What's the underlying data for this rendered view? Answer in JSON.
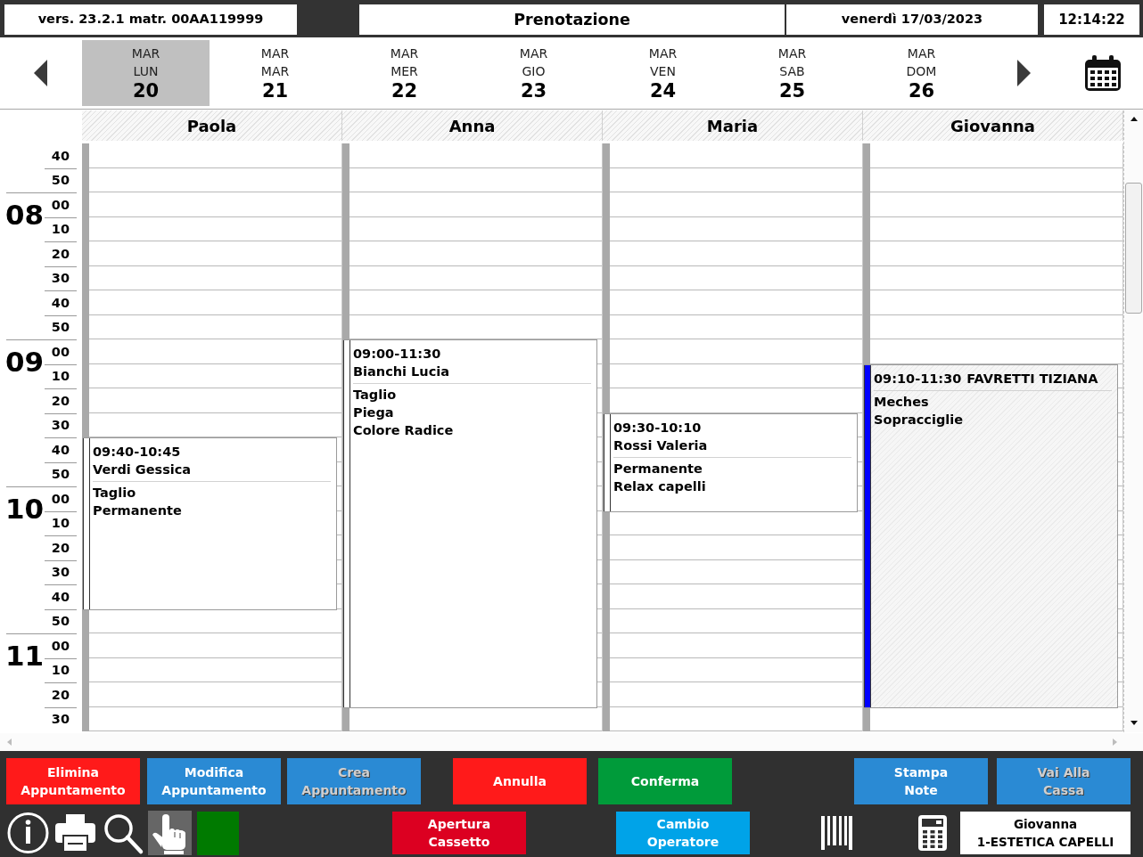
{
  "top_bar": {
    "version": "vers. 23.2.1 matr. 00AA119999",
    "title": "Prenotazione",
    "date": "venerdì 17/03/2023",
    "clock": "12:14:22"
  },
  "week": {
    "days": [
      {
        "month": "MAR",
        "weekday": "LUN",
        "day": "20",
        "selected": true
      },
      {
        "month": "MAR",
        "weekday": "MAR",
        "day": "21",
        "selected": false
      },
      {
        "month": "MAR",
        "weekday": "MER",
        "day": "22",
        "selected": false
      },
      {
        "month": "MAR",
        "weekday": "GIO",
        "day": "23",
        "selected": false
      },
      {
        "month": "MAR",
        "weekday": "VEN",
        "day": "24",
        "selected": false
      },
      {
        "month": "MAR",
        "weekday": "SAB",
        "day": "25",
        "selected": false
      },
      {
        "month": "MAR",
        "weekday": "DOM",
        "day": "26",
        "selected": false
      }
    ]
  },
  "schedule": {
    "time_slots": [
      {
        "minute": "40"
      },
      {
        "minute": "50"
      },
      {
        "hour": "08",
        "minute": "00"
      },
      {
        "minute": "10"
      },
      {
        "minute": "20"
      },
      {
        "minute": "30"
      },
      {
        "minute": "40"
      },
      {
        "minute": "50"
      },
      {
        "hour": "09",
        "minute": "00"
      },
      {
        "minute": "10"
      },
      {
        "minute": "20"
      },
      {
        "minute": "30"
      },
      {
        "minute": "40"
      },
      {
        "minute": "50"
      },
      {
        "hour": "10",
        "minute": "00"
      },
      {
        "minute": "10"
      },
      {
        "minute": "20"
      },
      {
        "minute": "30"
      },
      {
        "minute": "40"
      },
      {
        "minute": "50"
      },
      {
        "hour": "11",
        "minute": "00"
      },
      {
        "minute": "10"
      },
      {
        "minute": "20"
      },
      {
        "minute": "30"
      }
    ],
    "operators": [
      {
        "name": "Paola",
        "appointments": [
          {
            "kind": "stacked",
            "time": "09:40-10:45",
            "client": "Verdi Gessica",
            "services": [
              "Taglio",
              "Permanente"
            ],
            "color": "#ffffff"
          }
        ]
      },
      {
        "name": "Anna",
        "appointments": [
          {
            "kind": "stacked",
            "time": "09:00-11:30",
            "client": "Bianchi Lucia",
            "services": [
              "Taglio",
              "Piega",
              "Colore Radice"
            ],
            "color": "#ffffff"
          }
        ]
      },
      {
        "name": "Maria",
        "appointments": [
          {
            "kind": "stacked",
            "time": "09:30-10:10",
            "client": "Rossi Valeria",
            "services": [
              "Permanente",
              "Relax capelli"
            ],
            "color": "#ffffff"
          }
        ]
      },
      {
        "name": "Giovanna",
        "appointments": [
          {
            "kind": "inline",
            "time": "09:10-11:30",
            "client": "FAVRETTI TIZIANA",
            "services": [
              "Meches",
              "Sopracciglie"
            ],
            "color": "#0000ff"
          }
        ]
      }
    ]
  },
  "actions": [
    {
      "label": "Elimina\nAppuntamento",
      "color": "#ff1a1a",
      "disabled": false
    },
    {
      "label": "Modifica\nAppuntamento",
      "color": "#2a8ad4",
      "disabled": false
    },
    {
      "label": "Crea\nAppuntamento",
      "color": "#2a8ad4",
      "disabled": true
    },
    {
      "label": "Annulla",
      "color": "#ff1a1a",
      "disabled": false
    },
    {
      "label": "Conferma",
      "color": "#009b3a",
      "disabled": false
    },
    {
      "label": "Stampa\nNote",
      "color": "#2a8ad4",
      "disabled": false
    },
    {
      "label": "Vai Alla\nCassa",
      "color": "#2a8ad4",
      "disabled": true
    }
  ],
  "footer": {
    "tools": [
      {
        "kind": "info",
        "selected": false
      },
      {
        "kind": "print",
        "selected": false
      },
      {
        "kind": "search",
        "selected": false
      },
      {
        "kind": "pointer",
        "selected": true
      }
    ],
    "status_light": {
      "on": true
    },
    "buttons": [
      {
        "label": "Apertura\nCassetto",
        "color": "#dc0021"
      },
      {
        "label": "Cambio\nOperatore",
        "color": "#00a3e8"
      }
    ],
    "operator": {
      "name": "Giovanna",
      "role": "1-ESTETICA CAPELLI"
    }
  }
}
